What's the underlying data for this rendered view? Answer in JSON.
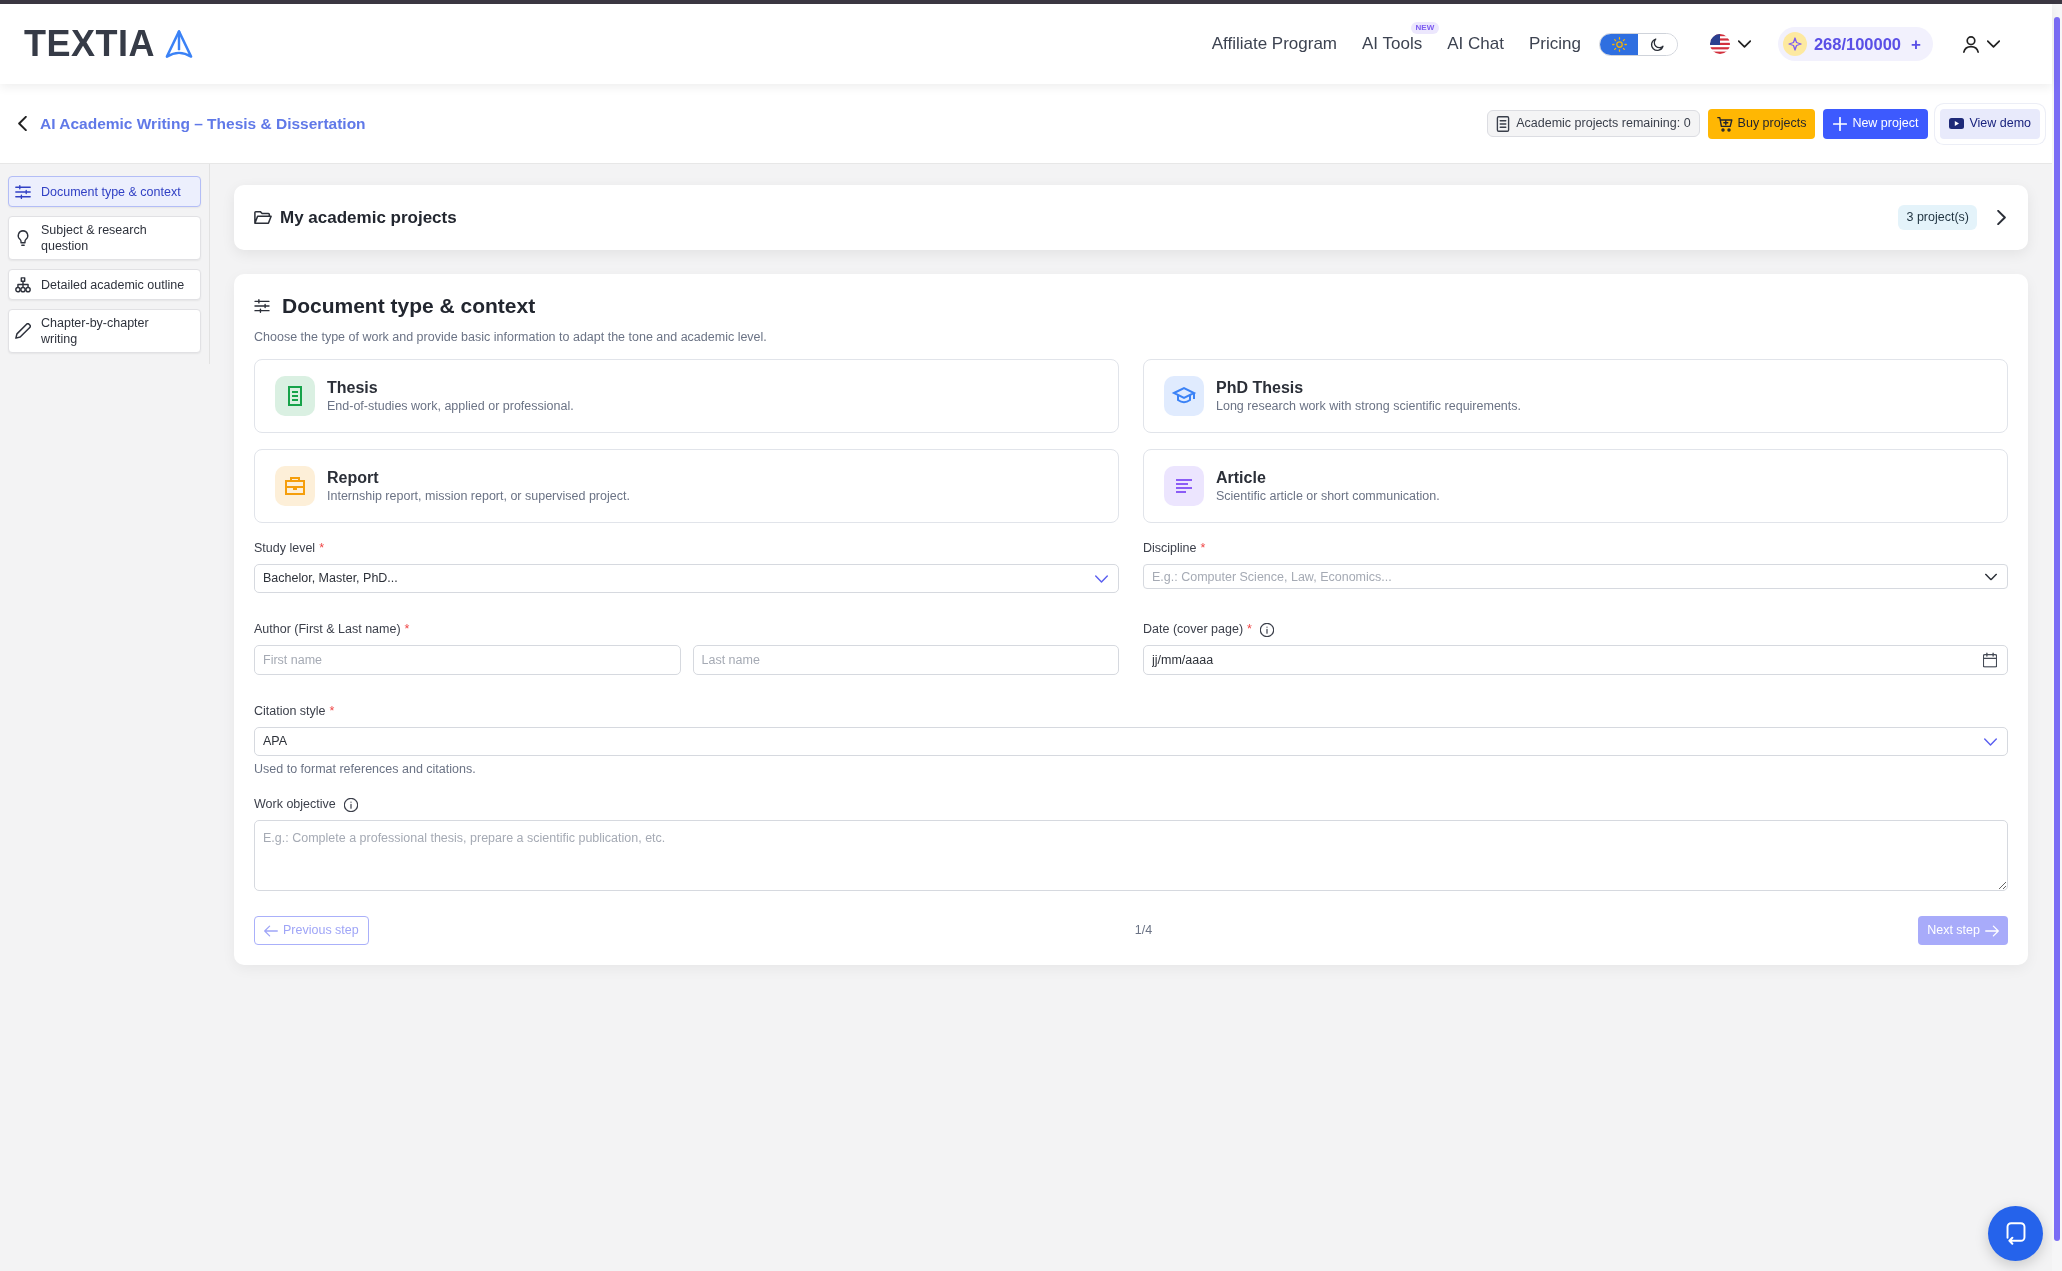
{
  "header": {
    "logo": "TEXTIA",
    "nav": [
      {
        "label": "Affiliate Program"
      },
      {
        "label": "AI Tools",
        "badge": "NEW"
      },
      {
        "label": "AI Chat"
      },
      {
        "label": "Pricing"
      }
    ],
    "theme_toggle": [
      {
        "kind": "light",
        "selected": true
      },
      {
        "kind": "dark",
        "selected": false
      }
    ],
    "credits": {
      "value": "268/100000",
      "add": "+"
    }
  },
  "page_header": {
    "title": "AI Academic Writing – Thesis & Dissertation",
    "remaining": "Academic projects remaining: 0",
    "buttons": [
      {
        "kind": "buy",
        "label": "Buy projects"
      },
      {
        "kind": "new",
        "label": "New project"
      },
      {
        "kind": "demo",
        "label": "View demo"
      }
    ]
  },
  "steps": [
    {
      "kind": "context",
      "label": "Document type & context",
      "selected": true
    },
    {
      "kind": "subject",
      "label": "Subject & research question",
      "selected": false
    },
    {
      "kind": "outline",
      "label": "Detailed academic outline",
      "selected": false
    },
    {
      "kind": "writing",
      "label": "Chapter-by-chapter writing",
      "selected": false
    }
  ],
  "projects_panel": {
    "title": "My academic projects",
    "count": "3 project(s)"
  },
  "form": {
    "title": "Document type & context",
    "subtitle": "Choose the type of work and provide basic information to adapt the tone and academic level.",
    "document_types": [
      {
        "kind": "thesis",
        "title": "Thesis",
        "description": "End-of-studies work, applied or professional.",
        "color": "#16a34a",
        "selected": false
      },
      {
        "kind": "phd",
        "title": "PhD Thesis",
        "description": "Long research work with strong scientific requirements.",
        "color": "#3b82f6",
        "selected": false
      },
      {
        "kind": "report",
        "title": "Report",
        "description": "Internship report, mission report, or supervised project.",
        "color": "#f59e0b",
        "selected": false
      },
      {
        "kind": "article",
        "title": "Article",
        "description": "Scientific article or short communication.",
        "color": "#8b5cf6",
        "selected": false
      }
    ],
    "field_rows": [
      [
        {
          "kind": "select",
          "label": "Study level",
          "required_mark": "*",
          "value": "Bachelor, Master, PhD..."
        },
        {
          "kind": "combobox",
          "label": "Discipline",
          "required_mark": "*",
          "placeholder": "E.g.: Computer Science, Law, Economics..."
        }
      ],
      [
        {
          "kind": "name_pair",
          "label": "Author (First & Last name)",
          "required_mark": "*",
          "inputs": [
            {
              "placeholder": "First name"
            },
            {
              "placeholder": "Last name"
            }
          ]
        },
        {
          "kind": "date",
          "label": "Date (cover page)",
          "required_mark": "*",
          "info": true,
          "placeholder": "jj/mm/aaaa"
        }
      ],
      [
        {
          "kind": "select",
          "label": "Citation style",
          "required_mark": "*",
          "value": "APA",
          "help": "Used to format references and citations."
        }
      ],
      [
        {
          "kind": "textarea",
          "label": "Work objective",
          "info": true,
          "placeholder": "E.g.: Complete a professional thesis, prepare a scientific publication, etc."
        }
      ]
    ],
    "footer": {
      "previous": {
        "label": "Previous step",
        "disabled": true
      },
      "progress": "1/4",
      "next": {
        "label": "Next step",
        "disabled": true
      }
    }
  }
}
